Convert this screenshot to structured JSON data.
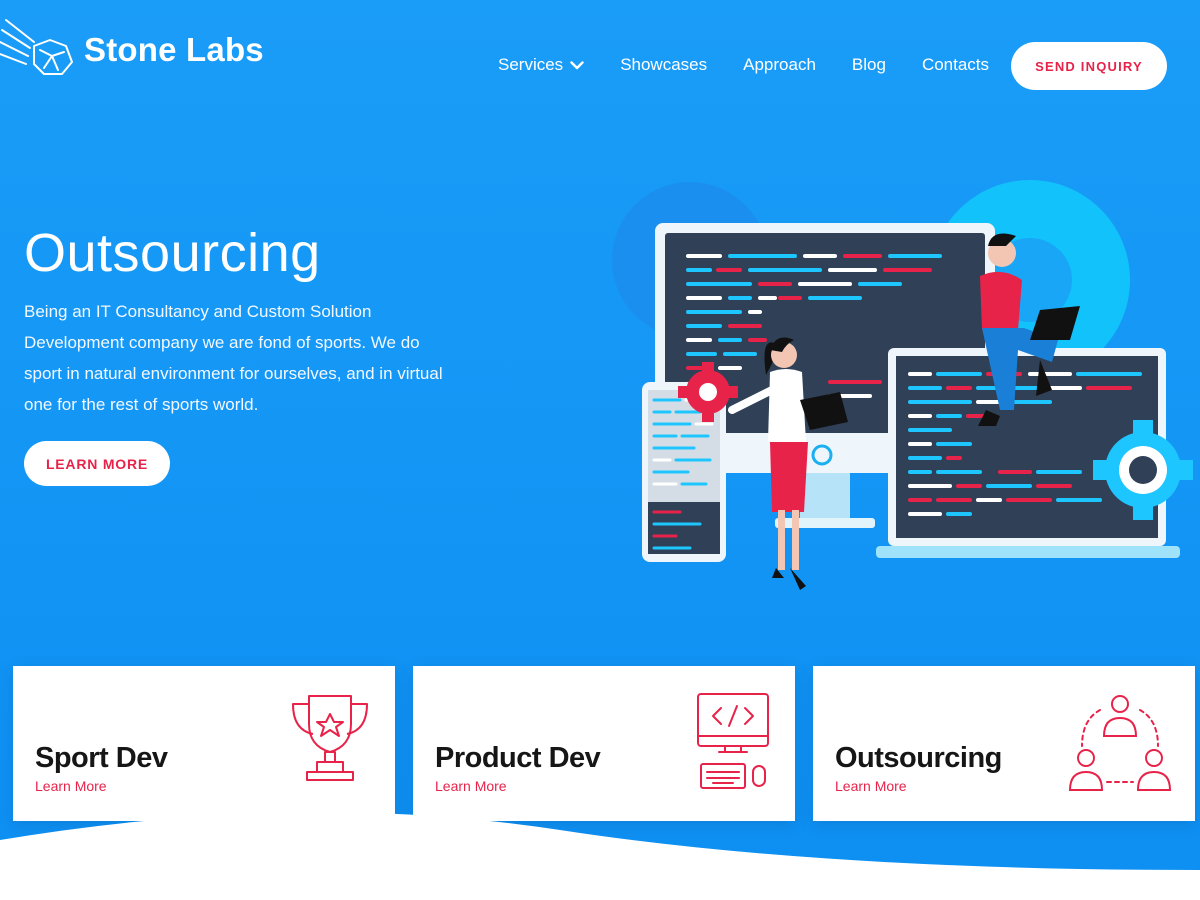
{
  "brand": {
    "name": "Stone Labs",
    "logo_icon": "meteor-stone-icon"
  },
  "nav": {
    "items": [
      {
        "label": "Services",
        "has_dropdown": true
      },
      {
        "label": "Showcases"
      },
      {
        "label": "Approach"
      },
      {
        "label": "Blog"
      },
      {
        "label": "Contacts"
      }
    ],
    "cta_label": "SEND INQUIRY"
  },
  "hero": {
    "title": "Outsourcing",
    "description": "Being an IT Consultancy and Custom Solution Development company we are fond of sports. We do sport in natural environment for ourselves, and in virtual one for the rest of sports world.",
    "button_label": "LEARN MORE"
  },
  "cards": [
    {
      "title": "Sport Dev",
      "link": "Learn More",
      "icon": "trophy-icon"
    },
    {
      "title": "Product Dev",
      "link": "Learn More",
      "icon": "computer-code-icon"
    },
    {
      "title": "Outsourcing",
      "link": "Learn More",
      "icon": "team-network-icon"
    }
  ],
  "colors": {
    "background": "#1a9df8",
    "accent": "#e8234a",
    "card_bg": "#ffffff",
    "text_dark": "#161616"
  }
}
